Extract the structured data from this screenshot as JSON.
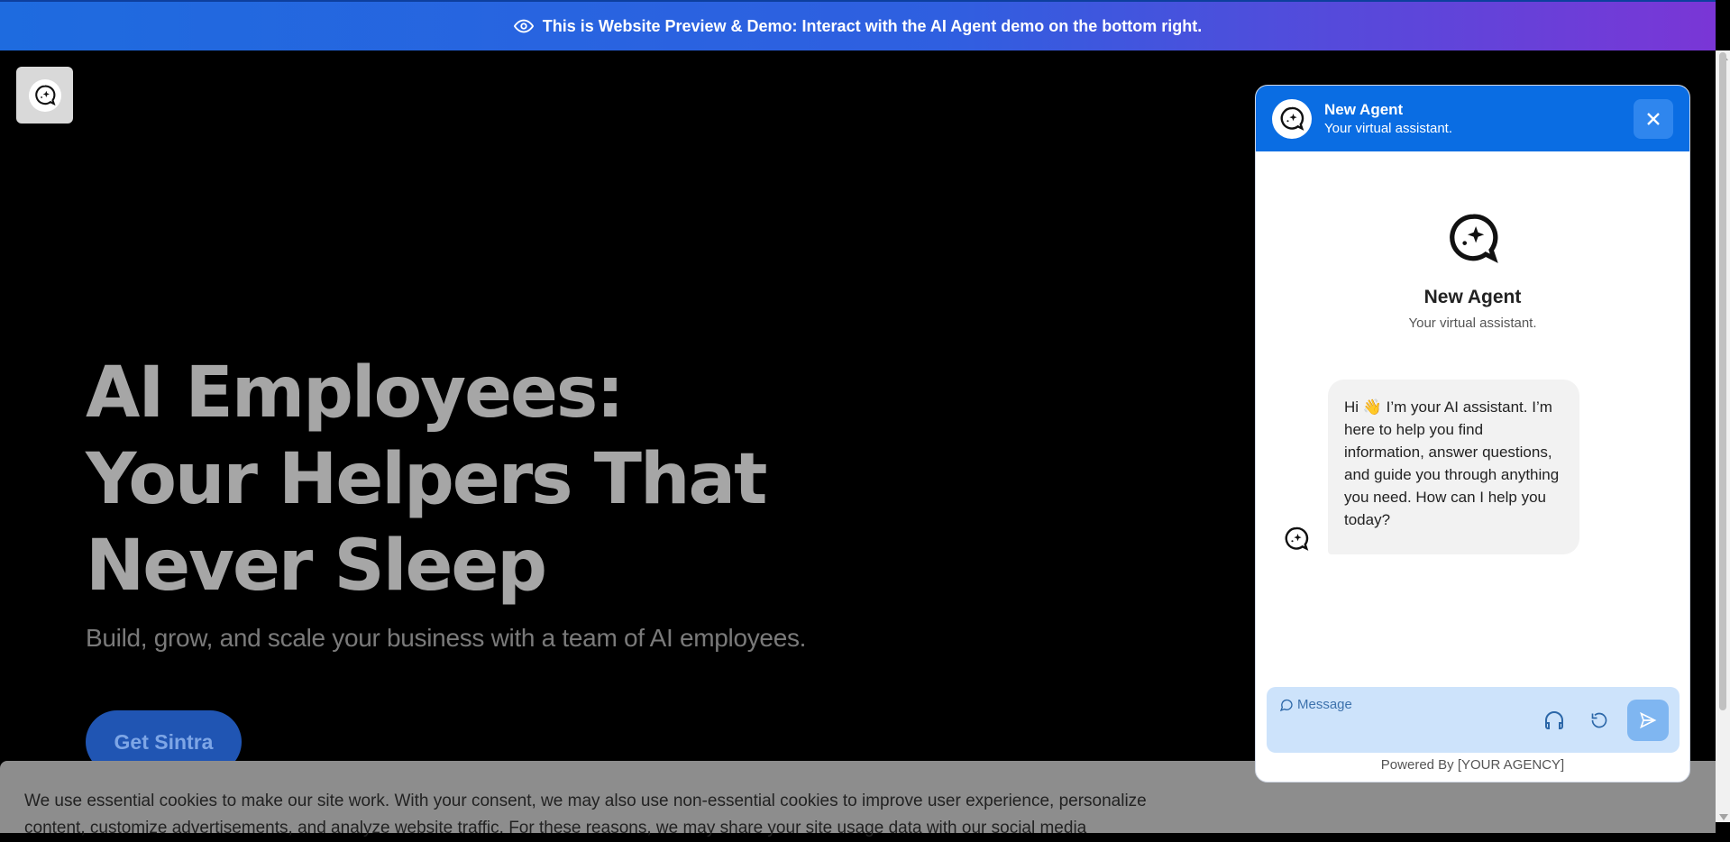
{
  "banner": {
    "text": "This is Website Preview & Demo: Interact with the AI Agent demo on the bottom right.",
    "icon": "eye-icon"
  },
  "site": {
    "logo_icon": "chat-sparkle-logo",
    "hero": {
      "title": "AI Employees: Your Helpers That Never Sleep",
      "subtitle": "Build, grow, and scale your business with a team of AI employees."
    },
    "cta_label": "Get Sintra"
  },
  "cookie_banner": {
    "line1": "We use essential cookies to make our site work. With your consent, we may also use non-essential cookies to improve user experience, personalize",
    "line2": "content, customize advertisements, and analyze website traffic. For these reasons, we may share your site usage data with our social media"
  },
  "chat_widget": {
    "header": {
      "title": "New Agent",
      "subtitle": "Your virtual assistant.",
      "close_icon": "close-icon"
    },
    "intro": {
      "name": "New Agent",
      "subtitle": "Your virtual assistant."
    },
    "messages": [
      {
        "sender": "bot",
        "text": "Hi 👋 I’m your AI assistant. I’m here to help you find information, answer questions, and guide you through anything you need. How can I help you today?"
      }
    ],
    "composer": {
      "placeholder": "Message",
      "icons": [
        "message-icon",
        "headphones-icon",
        "refresh-icon",
        "send-icon"
      ]
    },
    "powered_by": "Powered By [YOUR AGENCY]"
  },
  "colors": {
    "accent": "#0a6de3",
    "banner_start": "#1e6bdf",
    "banner_end": "#7a36d6",
    "composer_bg": "#cde3fb"
  }
}
